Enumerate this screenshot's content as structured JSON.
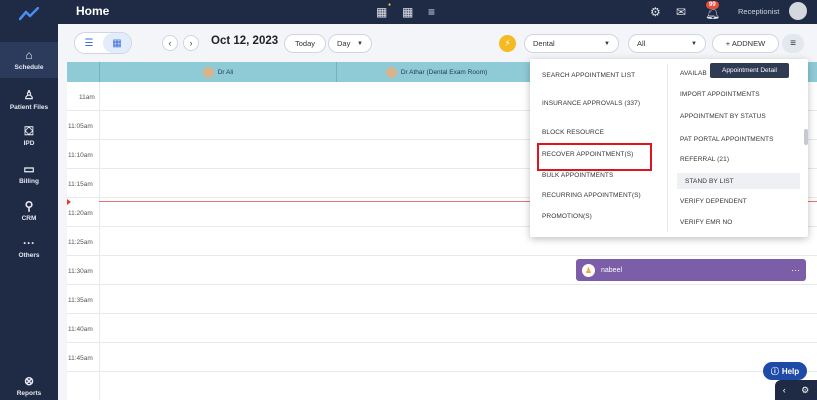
{
  "header": {
    "title": "Home",
    "role": "Receptionist",
    "notification_count": "99"
  },
  "sidebar": {
    "items": [
      {
        "label": "Schedule",
        "icon": "home-icon"
      },
      {
        "label": "Patient Files",
        "icon": "person-icon"
      },
      {
        "label": "IPD",
        "icon": "bed-icon"
      },
      {
        "label": "Billing",
        "icon": "billing-icon"
      },
      {
        "label": "CRM",
        "icon": "crm-icon"
      },
      {
        "label": "Others",
        "icon": "more-icon"
      },
      {
        "label": "Reports",
        "icon": "reports-icon"
      }
    ]
  },
  "toolbar": {
    "date": "Oct 12, 2023",
    "today_label": "Today",
    "view_select": "Day",
    "department_select": "Dental",
    "filter_select": "All",
    "addnew_label": "+ ADDNEW"
  },
  "calendar": {
    "doctors": [
      "Dr Ali",
      "Dr Athar (Dental Exam Room)"
    ],
    "times": [
      "11am",
      "11:05am",
      "11:10am",
      "11:15am",
      "11:20am",
      "11:25am",
      "11:30am",
      "11:35am",
      "11:40am",
      "11:45am"
    ],
    "appointment": {
      "patient": "nabeel"
    }
  },
  "dropdown": {
    "left_items": [
      "SEARCH APPOINTMENT LIST",
      "INSURANCE APPROVALS (337)",
      "BLOCK RESOURCE",
      "RECOVER APPOINTMENT(S)",
      "BULK APPOINTMENTS",
      "RECURRING APPOINTMENT(S)",
      "PROMOTION(S)"
    ],
    "right_items": [
      "AVAILAB",
      "IMPORT APPOINTMENTS",
      "APPOINTMENT BY STATUS",
      "PAT PORTAL APPOINTMENTS",
      "REFERRAL (21)",
      "STAND BY LIST",
      "VERIFY DEPENDENT",
      "VERIFY EMR NO"
    ]
  },
  "tooltip": "Appointment Detail",
  "help_label": "Help"
}
